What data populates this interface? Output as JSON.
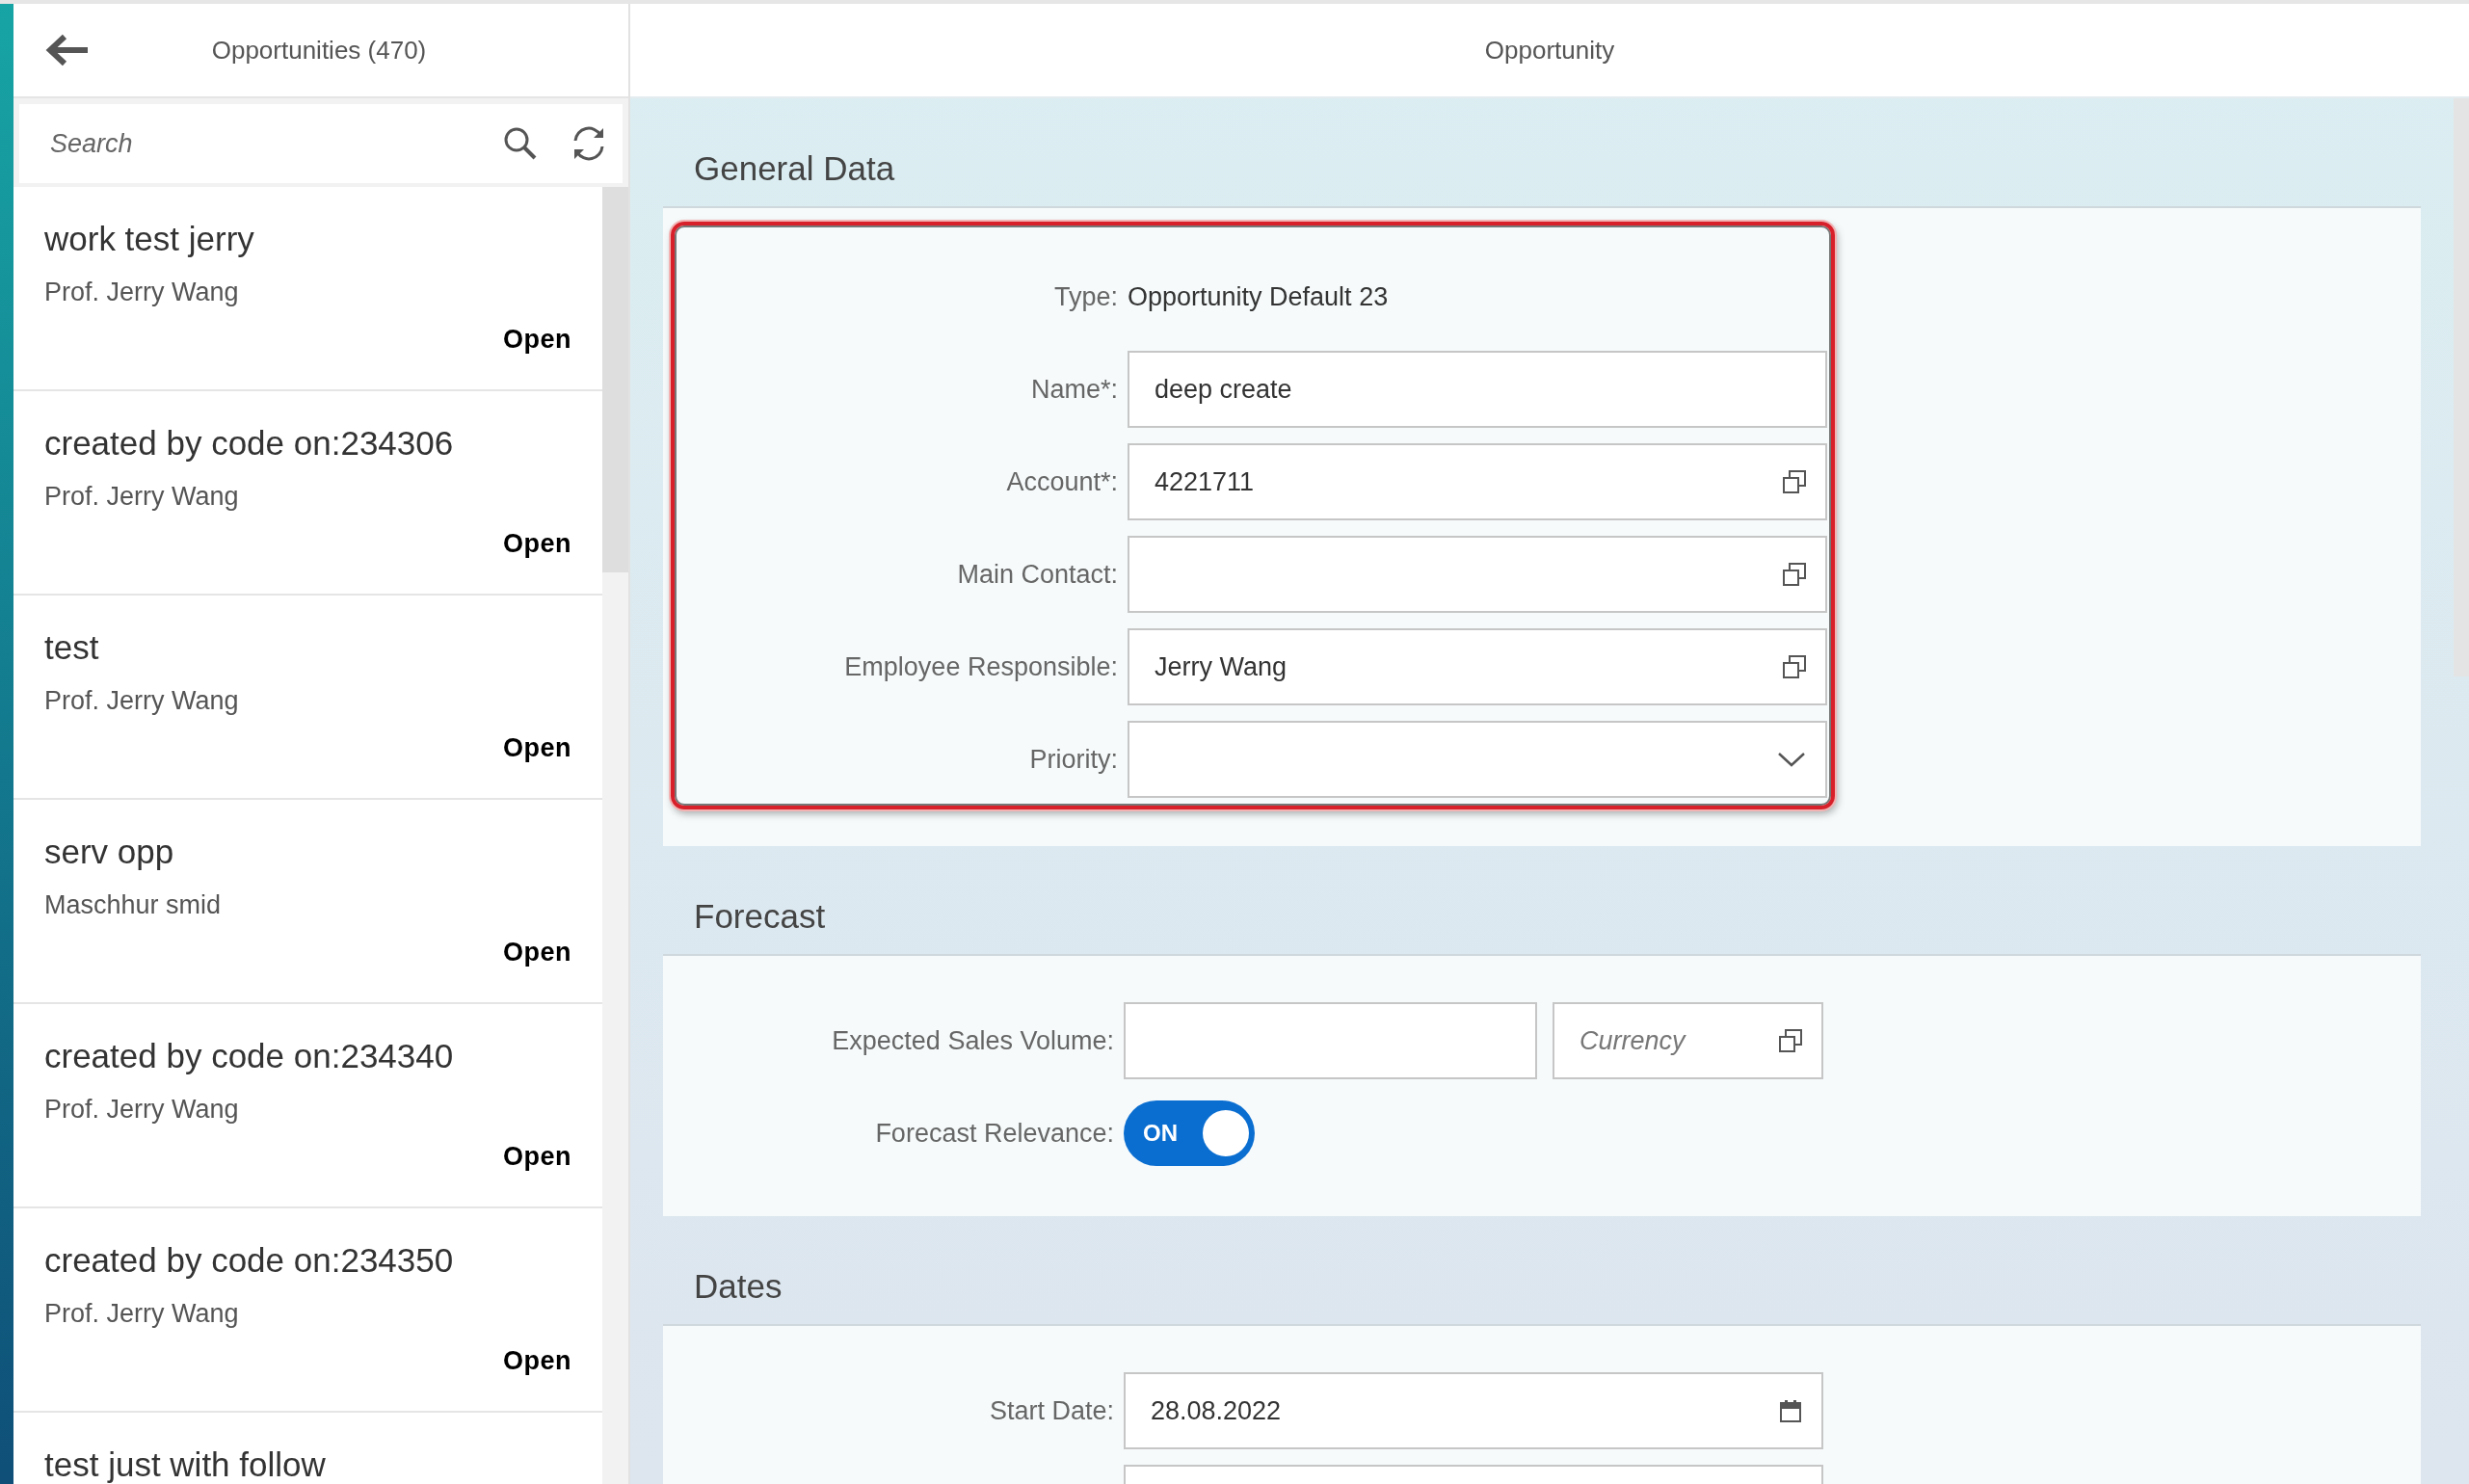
{
  "master": {
    "title": "Opportunities (470)",
    "search": {
      "placeholder": "Search"
    },
    "items": [
      {
        "title": "work test jerry",
        "subtitle": "Prof. Jerry Wang",
        "status": "Open"
      },
      {
        "title": "created by code on:234306",
        "subtitle": "Prof. Jerry Wang",
        "status": "Open"
      },
      {
        "title": "test",
        "subtitle": "Prof. Jerry Wang",
        "status": "Open"
      },
      {
        "title": "serv opp",
        "subtitle": "Maschhur smid",
        "status": "Open"
      },
      {
        "title": "created by code on:234340",
        "subtitle": "Prof. Jerry Wang",
        "status": "Open"
      },
      {
        "title": "created by code on:234350",
        "subtitle": "Prof. Jerry Wang",
        "status": "Open"
      },
      {
        "title": "test just with follow"
      }
    ]
  },
  "detail": {
    "title": "Opportunity",
    "sections": [
      {
        "title": "General Data",
        "highlighted": true,
        "rows": [
          {
            "label": "Type:",
            "controls": [
              {
                "kind": "text",
                "value": "Opportunity Default 23"
              }
            ]
          },
          {
            "label": "Name*:",
            "controls": [
              {
                "kind": "input",
                "value": "deep create"
              }
            ]
          },
          {
            "label": "Account*:",
            "controls": [
              {
                "kind": "valuehelp",
                "value": "4221711"
              }
            ]
          },
          {
            "label": "Main Contact:",
            "controls": [
              {
                "kind": "valuehelp"
              }
            ]
          },
          {
            "label": "Employee Responsible:",
            "controls": [
              {
                "kind": "valuehelp",
                "value": "Jerry Wang"
              }
            ]
          },
          {
            "label": "Priority:",
            "controls": [
              {
                "kind": "select"
              }
            ]
          }
        ]
      },
      {
        "title": "Forecast",
        "highlighted": false,
        "rows": [
          {
            "label": "Expected Sales Volume:",
            "controls": [
              {
                "kind": "input"
              },
              {
                "kind": "valuehelp",
                "placeholder": "Currency"
              }
            ]
          },
          {
            "label": "Forecast Relevance:",
            "controls": [
              {
                "kind": "switch",
                "on": true,
                "text": "ON"
              }
            ]
          }
        ]
      },
      {
        "title": "Dates",
        "highlighted": false,
        "rows": [
          {
            "label": "Start Date:",
            "controls": [
              {
                "kind": "date",
                "value": "28.08.2022"
              }
            ]
          },
          {
            "controls": [
              {
                "kind": "input"
              }
            ]
          }
        ]
      }
    ]
  }
}
